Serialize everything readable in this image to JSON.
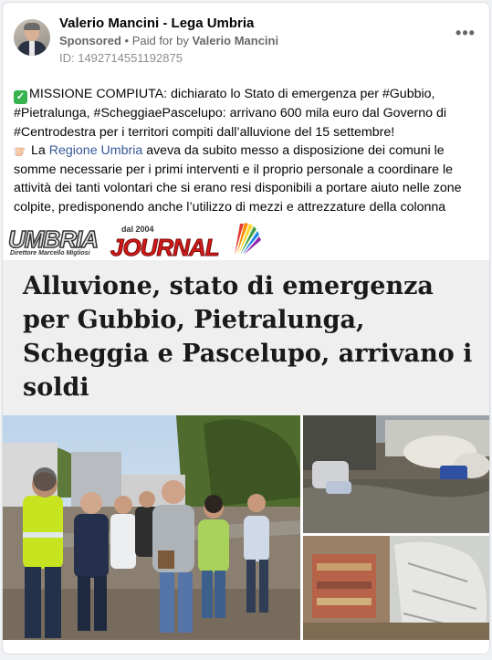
{
  "post": {
    "author": "Valerio Mancini - Lega Umbria",
    "sponsored": "Sponsored",
    "dot": " • ",
    "paid_for_prefix": "Paid for by ",
    "payer": "Valerio Mancini",
    "ad_id": "ID: 1492714551192875",
    "more_icon": "more-horizontal-icon",
    "more_label": "•••",
    "paragraph1": "MISSIONE COMPIUTA: dichiarato lo Stato di emergenza per #Gubbio, #Pietralunga, #ScheggiaePascelupo: arrivano 600 mila euro dal Governo di #Centrodestra per i territori compiti dall’alluvione del 15 settembre!",
    "paragraph2_before_link": "La ",
    "paragraph2_link": "Regione Umbria",
    "paragraph2_after_link": " aveva da subito messo a disposizione dei comuni le somme necessarie per i primi interventi e il proprio personale a coordinare le attività dei tanti volontari che si erano resi disponibili a portare aiuto nelle zone colpite, predisponendo anche l’utilizzo di mezzi e attrezzature della colonna mobile…."
  },
  "media": {
    "logo_text_1": "UMBRIA",
    "logo_text_2": "JOURNAL",
    "logo_year": "dal 2004",
    "logo_director": "Direttore Marcello Migliosi",
    "headline": "Alluvione, stato di emergenza per Gubbio, Pietralunga, Scheggia e Pascelupo, arrivano i soldi"
  },
  "colors": {
    "link": "#385898",
    "headline_bg": "#efefef",
    "check_emoji": "#37b24d",
    "logo_red": "#d11a1a"
  }
}
